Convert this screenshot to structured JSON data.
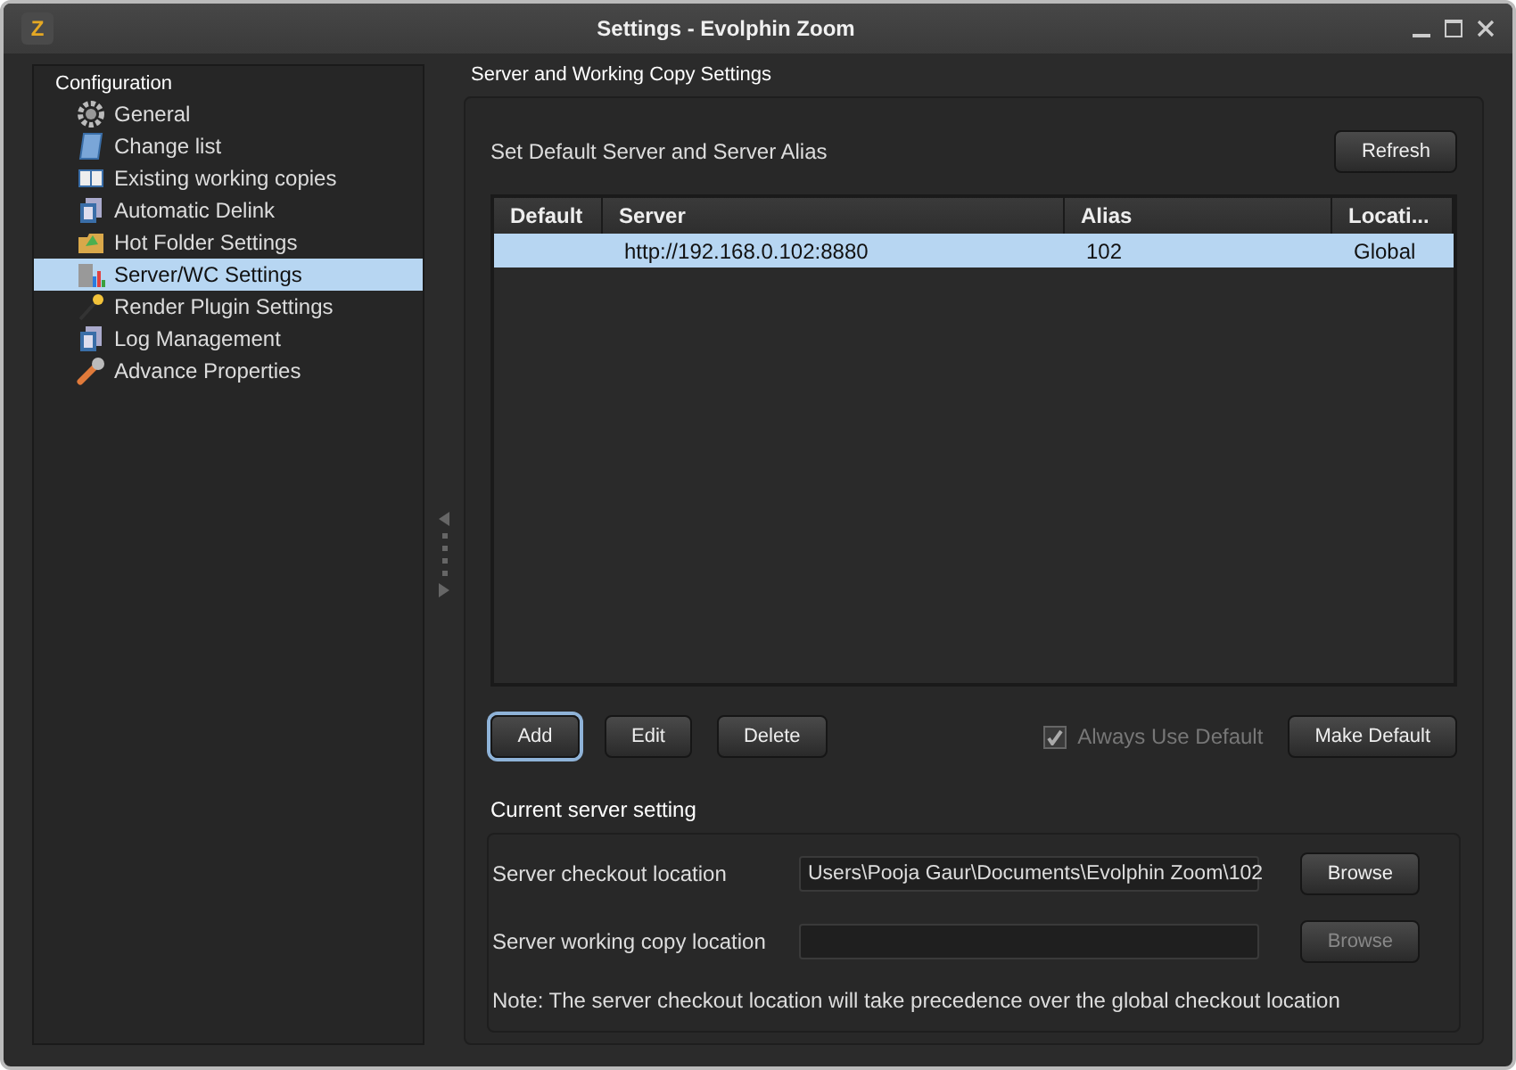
{
  "window": {
    "logo": "Z",
    "title": "Settings - Evolphin Zoom"
  },
  "sidebar": {
    "title": "Configuration",
    "items": [
      {
        "label": "General",
        "selected": false
      },
      {
        "label": "Change list",
        "selected": false
      },
      {
        "label": "Existing working copies",
        "selected": false
      },
      {
        "label": "Automatic Delink",
        "selected": false
      },
      {
        "label": "Hot Folder Settings",
        "selected": false
      },
      {
        "label": "Server/WC Settings",
        "selected": true
      },
      {
        "label": "Render Plugin Settings",
        "selected": false
      },
      {
        "label": "Log Management",
        "selected": false
      },
      {
        "label": "Advance Properties",
        "selected": false
      }
    ]
  },
  "content": {
    "title": "Server and Working Copy Settings",
    "servers": {
      "caption": "Set Default Server and Server Alias",
      "refresh": "Refresh",
      "columns": [
        "Default",
        "Server",
        "Alias",
        "Locati..."
      ],
      "rows": [
        {
          "cells": [
            "",
            "http://192.168.0.102:8880",
            "102",
            "Global"
          ],
          "selected": true
        }
      ],
      "buttons": [
        {
          "label": "Add",
          "focused": true
        },
        {
          "label": "Edit",
          "focused": false
        },
        {
          "label": "Delete",
          "focused": false
        }
      ],
      "always_default": {
        "label": "Always Use Default",
        "checked": true,
        "disabled": true
      },
      "make_default": "Make Default"
    },
    "current": {
      "title": "Current server setting",
      "fields": [
        {
          "label": "Server checkout location",
          "value": "Users\\Pooja Gaur\\Documents\\Evolphin Zoom\\102",
          "button": "Browse",
          "disabled": false
        },
        {
          "label": "Server working copy location",
          "button": "Browse",
          "disabled": true
        }
      ],
      "note": "Note: The server checkout location will take precedence over the global checkout location"
    }
  }
}
